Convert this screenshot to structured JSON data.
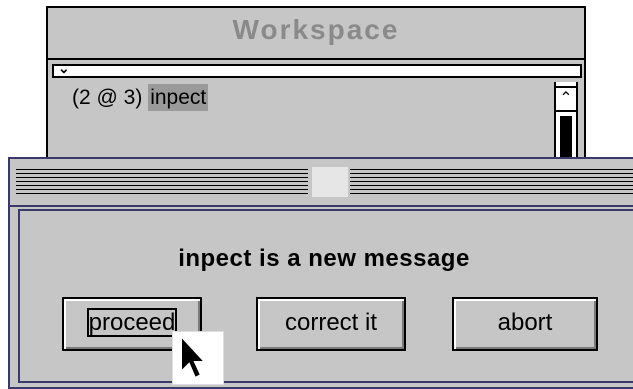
{
  "workspace": {
    "title": "Workspace",
    "code_prefix": "(2 @ 3)",
    "code_selected": "inpect"
  },
  "dialog": {
    "message": "inpect is a new message",
    "buttons": {
      "proceed": "proceed",
      "correct": "correct it",
      "abort": "abort"
    }
  },
  "icons": {
    "menu": "chevron-down-icon",
    "scroll_up": "up-arrow-icon",
    "pointer": "mouse-pointer-icon"
  }
}
